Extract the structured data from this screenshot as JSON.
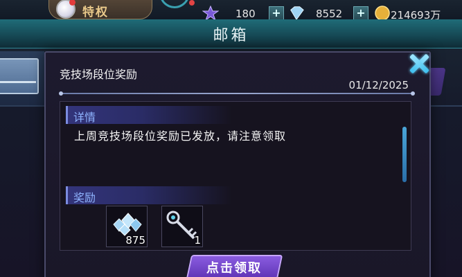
{
  "header": {
    "privilege_label": "特权",
    "title": "邮箱"
  },
  "resources": {
    "stamina": {
      "value": "180",
      "icon": "star-crystal-icon"
    },
    "diamond": {
      "value": "8552",
      "icon": "diamond-icon"
    },
    "gold": {
      "value": "214693万",
      "icon": "gold-coin-icon"
    }
  },
  "dialog": {
    "title": "竞技场段位奖励",
    "date": "01/12/2025",
    "details_heading": "详情",
    "details_text": "上周竞技场段位奖励已发放，请注意领取",
    "rewards_heading": "奖励",
    "rewards": [
      {
        "icon": "diamond-pile-icon",
        "count": "875"
      },
      {
        "icon": "key-icon",
        "count": "1"
      }
    ],
    "claim_label": "点击领取"
  },
  "colors": {
    "accent_teal": "#1f6c78",
    "section_blue": "#8fb4ff",
    "claim_purple": "#7a4ad0",
    "close_cyan": "#3ec0f0"
  }
}
